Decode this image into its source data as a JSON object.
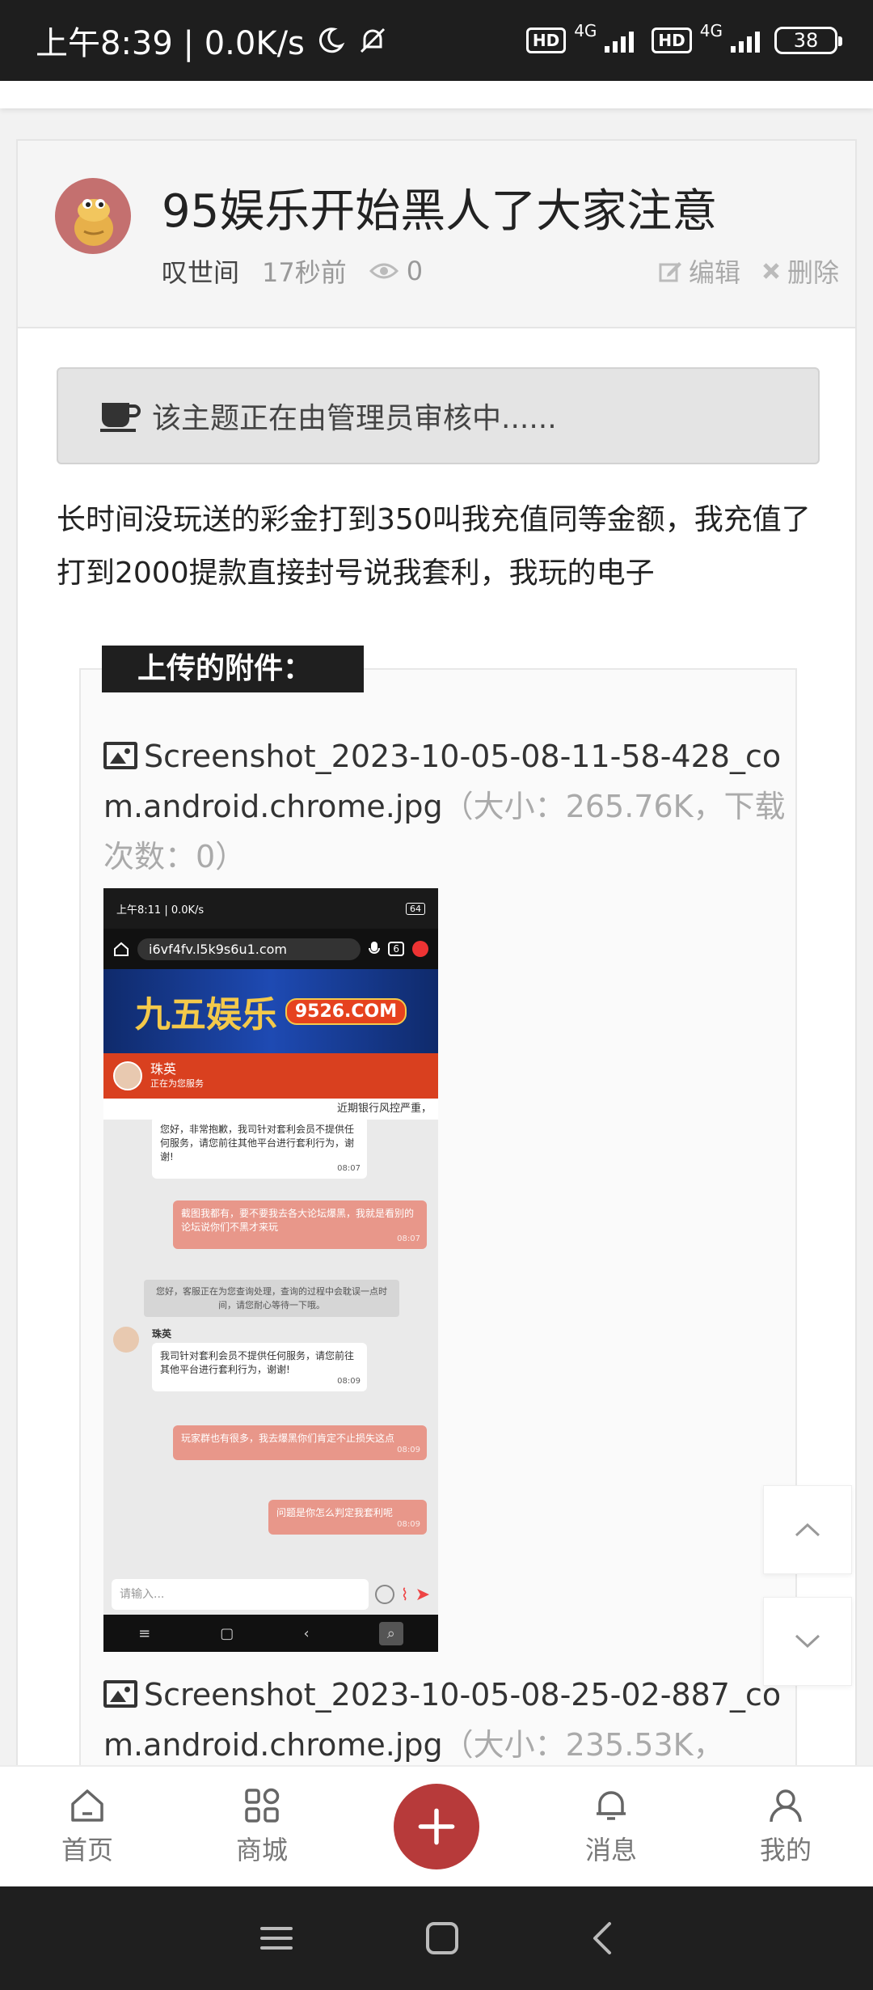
{
  "status_bar": {
    "time_speed": "上午8:39 | 0.0K/s",
    "hd1": "HD",
    "net1": "4G",
    "hd2": "HD",
    "net2": "4G",
    "battery": "38"
  },
  "post": {
    "title": "95娱乐开始黑人了大家注意",
    "author": "叹世间",
    "time": "17秒前",
    "views": "0",
    "edit_label": "编辑",
    "delete_label": "删除",
    "notice": "该主题正在由管理员审核中......",
    "body": "长时间没玩送的彩金打到350叫我充值同等金额，我充值了打到2000提款直接封号说我套利，我玩的电子"
  },
  "attachments": {
    "title": "上传的附件：",
    "files": [
      {
        "name": "Screenshot_2023-10-05-08-11-58-428_com.android.chrome.jpg",
        "meta": "（大小：265.76K，下载次数：0）"
      },
      {
        "name": "Screenshot_2023-10-05-08-25-02-887_com.android.chrome.jpg",
        "meta": "（大小：235.53K，"
      }
    ]
  },
  "screenshot": {
    "status_time": "上午8:11 | 0.0K/s",
    "battery": "64",
    "url": "i6vf4fv.l5k9s6u1.com",
    "tab_count": "6",
    "brand": "九五娱乐",
    "domain_badge": "9526.COM",
    "agent_name": "珠英",
    "agent_status": "正在为您服务",
    "marquee": "近期银行风控严重，",
    "messages": [
      {
        "text": "您好，非常抱歉，我司针对套利会员不提供任何服务，请您前往其他平台进行套利行为，谢谢!",
        "time": "08:07"
      },
      {
        "text": "截图我都有，要不要我去各大论坛爆黑，我就是看别的论坛说你们不黑才来玩",
        "time": "08:07"
      },
      {
        "text": "您好，客服正在为您查询处理，查询的过程中会耽误一点时间，请您耐心等待一下哦。"
      },
      {
        "sender": "珠英",
        "text": "我司针对套利会员不提供任何服务，请您前往其他平台进行套利行为，谢谢!",
        "time": "08:09"
      },
      {
        "text": "玩家群也有很多，我去爆黑你们肯定不止损失这点",
        "time": "08:09"
      },
      {
        "text": "问题是你怎么判定我套利呢",
        "time": "08:09"
      }
    ],
    "input_placeholder": "请输入..."
  },
  "tabbar": {
    "home": "首页",
    "shop": "商城",
    "messages": "消息",
    "mine": "我的"
  },
  "colors": {
    "accent": "#b73a3a",
    "chat_orange": "#d9401f",
    "outgoing_bubble": "#e8978a"
  }
}
